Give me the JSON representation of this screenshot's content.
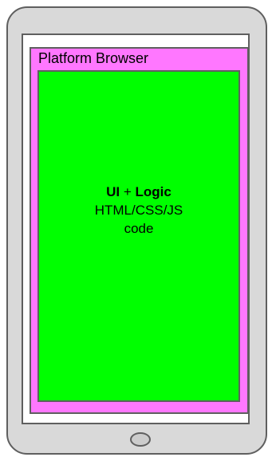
{
  "diagram": {
    "browser_label": "Platform Browser",
    "app": {
      "ui": "UI",
      "plus": " + ",
      "logic": "Logic",
      "line2": "HTML/CSS/JS",
      "line3": "code"
    }
  },
  "colors": {
    "phone_body": "#d9d9d9",
    "screen": "#ffffff",
    "browser": "#ff77ff",
    "app": "#00ff00",
    "outline": "#5f5f5f"
  }
}
